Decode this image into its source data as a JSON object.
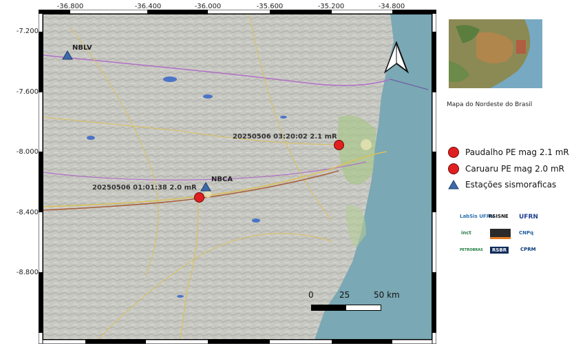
{
  "axes": {
    "x_ticks": [
      "-36.800",
      "-36.400",
      "-36.000",
      "-35.600",
      "-35.200",
      "-34.800"
    ],
    "y_ticks": [
      "-7.200",
      "-7.600",
      "-8.000",
      "-8.400",
      "-8.800"
    ]
  },
  "stations": [
    {
      "code": "NBLV"
    },
    {
      "code": "NBCA"
    }
  ],
  "events": [
    {
      "label": "20250506 03:20:02 2.1 mR"
    },
    {
      "label": "20250506 01:01:38 2.0 mR"
    }
  ],
  "scalebar": {
    "ticks": [
      "0",
      "25",
      "50 km"
    ]
  },
  "inset": {
    "caption": "Mapa do  Nordeste do Brasil"
  },
  "legend": {
    "items": [
      {
        "label": "Paudalho PE mag 2.1 mR",
        "symbol": "red-circle"
      },
      {
        "label": "Caruaru PE mag 2.0 mR",
        "symbol": "red-circle"
      },
      {
        "label": "Estações sismoraficas",
        "symbol": "blue-triangle"
      }
    ]
  },
  "logos": {
    "labsis": "LabSis UFRN",
    "rsisne": "RSISNE",
    "ufrn": "UFRN",
    "inct": "inct",
    "cnpq": "CNPq",
    "petrobras": "PETROBRAS",
    "rsbr": "RSBR",
    "cprm": "CPRM"
  },
  "colors": {
    "event": "#e02020",
    "station": "#3d6aa8",
    "ocean": "#7aa8b4",
    "land": "#c9c9c4"
  }
}
